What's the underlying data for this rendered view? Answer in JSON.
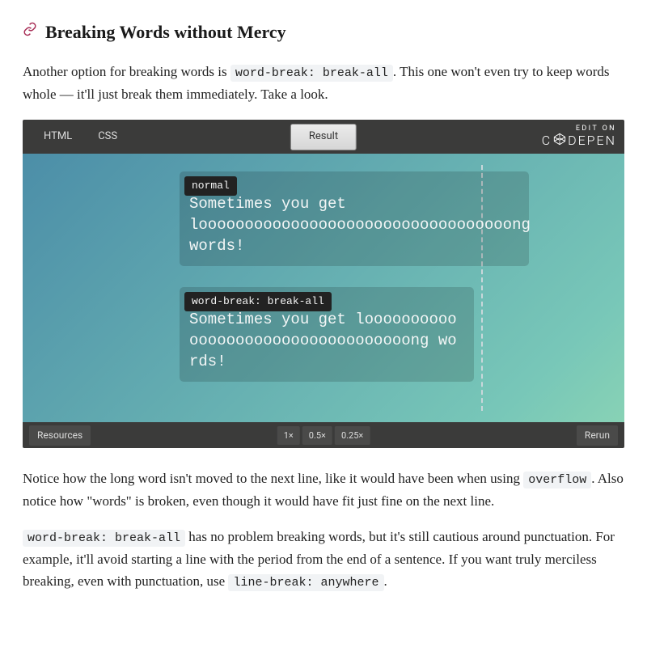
{
  "heading": "Breaking Words without Mercy",
  "para1_a": "Another option for breaking words is ",
  "para1_code": "word-break: break-all",
  "para1_b": ". This one won't even try to keep words whole — it'll just break them immediately. Take a look.",
  "codepen": {
    "tab_html": "HTML",
    "tab_css": "CSS",
    "result": "Result",
    "editon_small": "EDIT ON",
    "editon_brand": "C   DEPEN",
    "demo1_label": "normal",
    "demo1_text": "Sometimes you get loooooooooooooooooooooooooooooooooong words!",
    "demo2_label": "word-break: break-all",
    "demo2_text": "Sometimes you get loooooooooooooooooooooooooooooooooong words!",
    "resources": "Resources",
    "zoom1": "1×",
    "zoom2": "0.5×",
    "zoom3": "0.25×",
    "rerun": "Rerun"
  },
  "para2_a": "Notice how the long word isn't moved to the next line, like it would have been when using ",
  "para2_code": "overflow",
  "para2_b": ". Also notice how \"words\" is broken, even though it would have fit just fine on the next line.",
  "para3_code1": "word-break: break-all",
  "para3_a": " has no problem breaking words, but it's still cautious around punctuation. For example, it'll avoid starting a line with the period from the end of a sentence. If you want truly merciless breaking, even with punctuation, use ",
  "para3_code2": "line-break: anywhere",
  "para3_b": "."
}
